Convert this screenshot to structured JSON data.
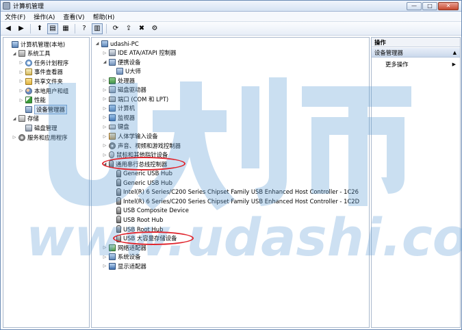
{
  "window": {
    "title": "计算机管理"
  },
  "menu": [
    "文件(F)",
    "操作(A)",
    "查看(V)",
    "帮助(H)"
  ],
  "toolbar": {
    "buttons": [
      {
        "name": "back-icon",
        "glyph": "◀"
      },
      {
        "name": "forward-icon",
        "glyph": "▶"
      },
      {
        "name": "up-folder-icon",
        "glyph": "⬆"
      },
      {
        "name": "show-tree-icon",
        "glyph": "▤",
        "pressed": true
      },
      {
        "name": "properties-icon",
        "glyph": "▦"
      },
      {
        "name": "help-icon",
        "glyph": "?"
      },
      {
        "name": "action-pane-icon",
        "glyph": "▥",
        "pressed": true
      },
      {
        "name": "scan-hardware-icon",
        "glyph": "⟳"
      },
      {
        "name": "update-driver-icon",
        "glyph": "⇪"
      },
      {
        "name": "uninstall-icon",
        "glyph": "✖"
      },
      {
        "name": "disable-icon",
        "glyph": "⚙"
      }
    ]
  },
  "left_tree": [
    {
      "label": "计算机管理(本地)",
      "icon": "ic-computer",
      "level": 0,
      "expander": "",
      "name": "tree-computer-management"
    },
    {
      "label": "系统工具",
      "icon": "ic-tools",
      "level": 1,
      "expander": "◢",
      "name": "tree-system-tools"
    },
    {
      "label": "任务计划程序",
      "icon": "ic-clock",
      "level": 2,
      "expander": "▷",
      "name": "tree-task-scheduler"
    },
    {
      "label": "事件查看器",
      "icon": "ic-log",
      "level": 2,
      "expander": "▷",
      "name": "tree-event-viewer"
    },
    {
      "label": "共享文件夹",
      "icon": "ic-folder",
      "level": 2,
      "expander": "▷",
      "name": "tree-shared-folders"
    },
    {
      "label": "本地用户和组",
      "icon": "ic-users",
      "level": 2,
      "expander": "▷",
      "name": "tree-local-users"
    },
    {
      "label": "性能",
      "icon": "ic-perf",
      "level": 2,
      "expander": "▷",
      "name": "tree-performance"
    },
    {
      "label": "设备管理器",
      "icon": "ic-device",
      "level": 2,
      "expander": "",
      "name": "tree-device-manager",
      "selected": true
    },
    {
      "label": "存储",
      "icon": "ic-storage",
      "level": 1,
      "expander": "◢",
      "name": "tree-storage"
    },
    {
      "label": "磁盘管理",
      "icon": "ic-disk",
      "level": 2,
      "expander": "",
      "name": "tree-disk-management"
    },
    {
      "label": "服务和应用程序",
      "icon": "ic-services",
      "level": 1,
      "expander": "▷",
      "name": "tree-services-apps"
    }
  ],
  "device_tree": [
    {
      "label": "udashi-PC",
      "icon": "ic-computer",
      "level": 0,
      "expander": "◢"
    },
    {
      "label": "IDE ATA/ATAPI 控制器",
      "icon": "ic-disk",
      "level": 1,
      "expander": "▷"
    },
    {
      "label": "便携设备",
      "icon": "ic-device",
      "level": 1,
      "expander": "◢"
    },
    {
      "label": "U大师",
      "icon": "ic-device",
      "level": 2,
      "expander": ""
    },
    {
      "label": "处理器",
      "icon": "ic-chip",
      "level": 1,
      "expander": "▷"
    },
    {
      "label": "磁盘驱动器",
      "icon": "ic-disk",
      "level": 1,
      "expander": "▷"
    },
    {
      "label": "端口 (COM 和 LPT)",
      "icon": "ic-port",
      "level": 1,
      "expander": "▷"
    },
    {
      "label": "计算机",
      "icon": "ic-computer",
      "level": 1,
      "expander": "▷"
    },
    {
      "label": "监视器",
      "icon": "ic-monitor",
      "level": 1,
      "expander": "▷"
    },
    {
      "label": "键盘",
      "icon": "ic-keyboard",
      "level": 1,
      "expander": "▷"
    },
    {
      "label": "人体学输入设备",
      "icon": "ic-hid",
      "level": 1,
      "expander": "▷"
    },
    {
      "label": "声音、视频和游戏控制器",
      "icon": "ic-sound",
      "level": 1,
      "expander": "▷"
    },
    {
      "label": "鼠标和其他指针设备",
      "icon": "ic-mouse",
      "level": 1,
      "expander": "▷"
    },
    {
      "label": "通用串行总线控制器",
      "icon": "ic-usb",
      "level": 1,
      "expander": "◢"
    },
    {
      "label": "Generic USB Hub",
      "icon": "ic-usb",
      "level": 2,
      "expander": ""
    },
    {
      "label": "Generic USB Hub",
      "icon": "ic-usb",
      "level": 2,
      "expander": ""
    },
    {
      "label": "Intel(R) 6 Series/C200 Series Chipset Family USB Enhanced Host Controller - 1C26",
      "icon": "ic-usb",
      "level": 2,
      "expander": ""
    },
    {
      "label": "Intel(R) 6 Series/C200 Series Chipset Family USB Enhanced Host Controller - 1C2D",
      "icon": "ic-usb",
      "level": 2,
      "expander": ""
    },
    {
      "label": "USB Composite Device",
      "icon": "ic-usb",
      "level": 2,
      "expander": ""
    },
    {
      "label": "USB Root Hub",
      "icon": "ic-usb",
      "level": 2,
      "expander": ""
    },
    {
      "label": "USB Root Hub",
      "icon": "ic-usb",
      "level": 2,
      "expander": ""
    },
    {
      "label": "USB 大容量存储设备",
      "icon": "ic-usb",
      "level": 2,
      "expander": ""
    },
    {
      "label": "网络适配器",
      "icon": "ic-net",
      "level": 1,
      "expander": "▷"
    },
    {
      "label": "系统设备",
      "icon": "ic-computer",
      "level": 1,
      "expander": "▷"
    },
    {
      "label": "显示适配器",
      "icon": "ic-monitor",
      "level": 1,
      "expander": "▷"
    }
  ],
  "actions": {
    "header": "操作",
    "section": "设备管理器",
    "more": "更多操作"
  },
  "watermark": {
    "logo": "U大师",
    "url": "www.udashi.com"
  },
  "colors": {
    "annotation": "#e0242c",
    "watermark": "#5b9bd5"
  }
}
